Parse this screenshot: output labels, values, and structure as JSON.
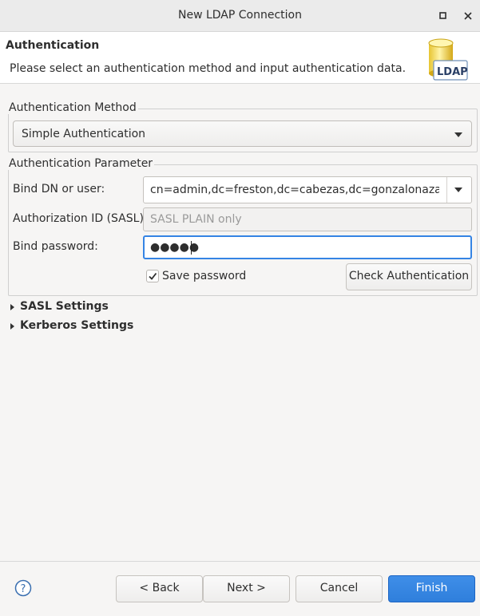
{
  "window": {
    "title": "New LDAP Connection",
    "maximize_icon": "maximize-icon",
    "close_icon": "close-icon"
  },
  "header": {
    "title": "Authentication",
    "description": "Please select an authentication method and input authentication data.",
    "logo_text": "LDAP"
  },
  "method_group": {
    "legend": "Authentication Method",
    "selected": "Simple Authentication"
  },
  "param_group": {
    "legend": "Authentication Parameter",
    "bind_dn_label": "Bind DN or user:",
    "bind_dn_value": "cn=admin,dc=freston,dc=cabezas,dc=gonzalonazareno",
    "authz_label": "Authorization ID (SASL):",
    "authz_placeholder": "SASL PLAIN only",
    "password_label": "Bind password:",
    "password_value": "●●●●●",
    "save_password_label": "Save password",
    "save_password_checked": true,
    "check_auth_label": "Check Authentication"
  },
  "sections": {
    "sasl": "SASL Settings",
    "kerberos": "Kerberos Settings"
  },
  "footer": {
    "help_icon": "help-icon",
    "back": "< Back",
    "next": "Next >",
    "cancel": "Cancel",
    "finish": "Finish"
  },
  "colors": {
    "accent": "#3584e4",
    "primary_button": "#3584e4"
  }
}
